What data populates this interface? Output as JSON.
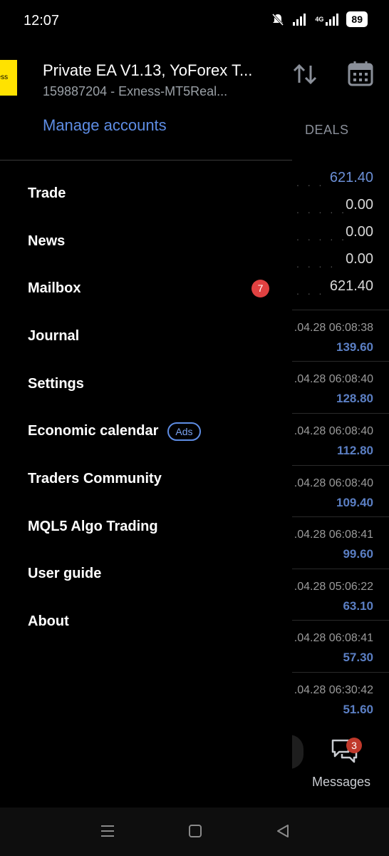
{
  "status_bar": {
    "time": "12:07",
    "network_label": "4G",
    "battery": "89"
  },
  "drawer": {
    "broker_logo_text": "ness",
    "account_name": "Private EA V1.13, YoForex T...",
    "account_id": "159887204 - Exness-MT5Real...",
    "manage_accounts": "Manage accounts",
    "menu": [
      {
        "label": "Trade"
      },
      {
        "label": "News"
      },
      {
        "label": "Mailbox",
        "badge": "7"
      },
      {
        "label": "Journal"
      },
      {
        "label": "Settings"
      },
      {
        "label": "Economic calendar",
        "tag": "Ads"
      },
      {
        "label": "Traders Community"
      },
      {
        "label": "MQL5 Algo Trading"
      },
      {
        "label": "User guide"
      },
      {
        "label": "About"
      }
    ]
  },
  "background": {
    "deals_tab": "DEALS",
    "summary_values": [
      "621.40",
      "0.00",
      "0.00",
      "0.00",
      "621.40"
    ],
    "deals": [
      {
        "time": ".04.28 06:08:38",
        "value": "139.60"
      },
      {
        "time": ".04.28 06:08:40",
        "value": "128.80"
      },
      {
        "time": ".04.28 06:08:40",
        "value": "112.80"
      },
      {
        "time": ".04.28 06:08:40",
        "value": "109.40"
      },
      {
        "time": ".04.28 06:08:41",
        "value": "99.60"
      },
      {
        "time": ".04.28 05:06:22",
        "value": "63.10"
      },
      {
        "time": ".04.28 06:08:41",
        "value": "57.30"
      },
      {
        "time": ".04.28 06:30:42",
        "value": "51.60"
      }
    ],
    "messages_label": "Messages",
    "messages_badge": "3"
  },
  "icons": {
    "sort": "sort-arrows-icon",
    "calendar": "calendar-icon",
    "messages": "chat-bubbles-icon",
    "nav_menu": "recent-apps-icon",
    "nav_home": "home-icon",
    "nav_back": "back-icon"
  },
  "colors": {
    "accent_blue": "#5e8de4",
    "badge_red": "#e04141",
    "logo_yellow": "#ffe200"
  }
}
